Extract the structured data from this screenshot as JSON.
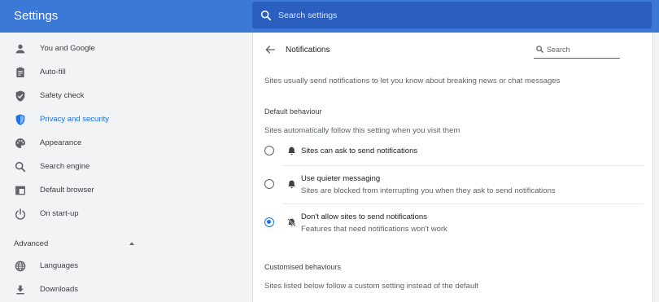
{
  "header": {
    "title": "Settings",
    "search_placeholder": "Search settings"
  },
  "sidebar": {
    "items": [
      {
        "label": "You and Google",
        "icon": "person-icon"
      },
      {
        "label": "Auto-fill",
        "icon": "clipboard-icon"
      },
      {
        "label": "Safety check",
        "icon": "shield-check-icon"
      },
      {
        "label": "Privacy and security",
        "icon": "shield-icon",
        "active": true
      },
      {
        "label": "Appearance",
        "icon": "palette-icon"
      },
      {
        "label": "Search engine",
        "icon": "search-icon"
      },
      {
        "label": "Default browser",
        "icon": "browser-window-icon"
      },
      {
        "label": "On start-up",
        "icon": "power-icon"
      }
    ],
    "advanced_label": "Advanced",
    "advanced_items": [
      {
        "label": "Languages",
        "icon": "globe-icon"
      },
      {
        "label": "Downloads",
        "icon": "download-icon"
      }
    ]
  },
  "main": {
    "title": "Notifications",
    "search_placeholder": "Search",
    "description": "Sites usually send notifications to let you know about breaking news or chat messages",
    "default_heading": "Default behaviour",
    "default_sub": "Sites automatically follow this setting when you visit them",
    "options": [
      {
        "label": "Sites can ask to send notifications",
        "sublabel": "",
        "icon": "bell-icon",
        "selected": false
      },
      {
        "label": "Use quieter messaging",
        "sublabel": "Sites are blocked from interrupting you when they ask to send notifications",
        "icon": "bell-icon",
        "selected": false
      },
      {
        "label": "Don't allow sites to send notifications",
        "sublabel": "Features that need notifications won't work",
        "icon": "bell-off-icon",
        "selected": true
      }
    ],
    "custom_heading": "Customised behaviours",
    "custom_sub": "Sites listed below follow a custom setting instead of the default"
  },
  "colors": {
    "header_bg": "#3c78d8",
    "accent": "#1a73e8",
    "sidebar_bg": "#f1f3f4"
  }
}
